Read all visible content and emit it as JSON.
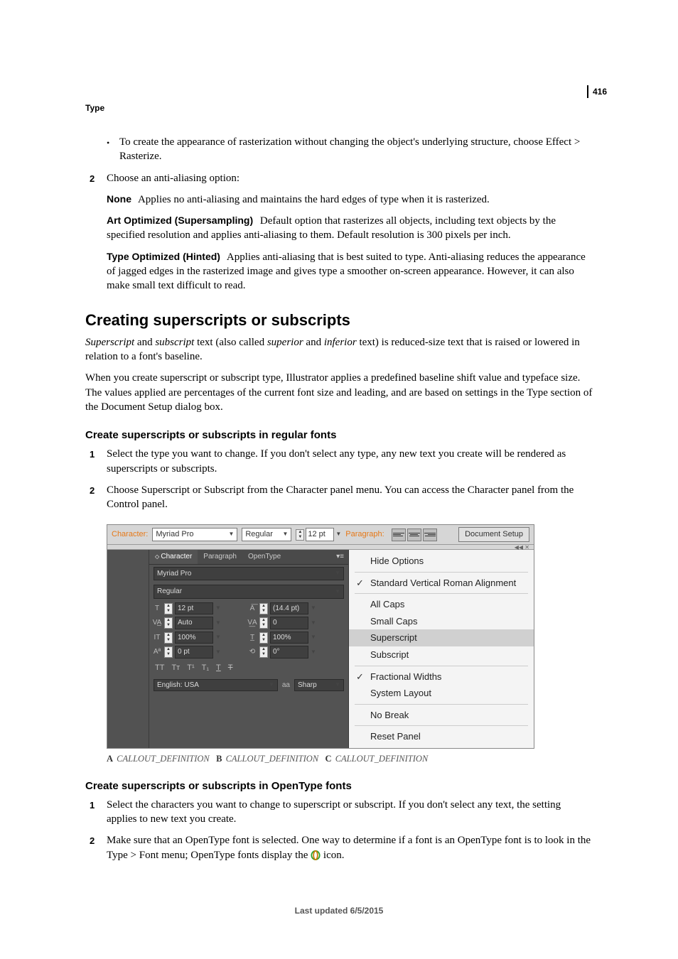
{
  "page_number": "416",
  "chapter": "Type",
  "intro_bullet": "To create the appearance of rasterization without changing the object's underlying structure, choose Effect > Rasterize.",
  "step2_lead": "Choose an anti-aliasing option:",
  "defs": {
    "none": {
      "term": "None",
      "body": "Applies no anti-aliasing and maintains the hard edges of type when it is rasterized."
    },
    "art": {
      "term": "Art Optimized (Supersampling)",
      "body": "Default option that rasterizes all objects, including text objects by the specified resolution and applies anti-aliasing to them. Default resolution is 300 pixels per inch."
    },
    "type": {
      "term": "Type Optimized (Hinted)",
      "body": "Applies anti-aliasing that is best suited to type. Anti-aliasing reduces the appearance of jagged edges in the rasterized image and gives type a smoother on-screen appearance. However, it can also make small text difficult to read."
    }
  },
  "h2": "Creating superscripts or subscripts",
  "p1a": "Superscript",
  "p1b": " and ",
  "p1c": "subscript",
  "p1d": " text (also called ",
  "p1e": "superior",
  "p1f": " and ",
  "p1g": "inferior",
  "p1h": " text) is reduced-size text that is raised or lowered in relation to a font's baseline.",
  "p2": "When you create superscript or subscript type, Illustrator applies a predefined baseline shift value and typeface size. The values applied are percentages of the current font size and leading, and are based on settings in the Type section of the Document Setup dialog box.",
  "h3a": "Create superscripts or subscripts in regular fonts",
  "h3a_step1": "Select the type you want to change. If you don't select any type, any new text you create will be rendered as superscripts or subscripts.",
  "h3a_step2": "Choose Superscript or Subscript from the Character panel menu. You can access the Character panel from the Control panel.",
  "ctrlbar": {
    "character_label": "Character:",
    "font": "Myriad Pro",
    "style": "Regular",
    "size": "12 pt",
    "paragraph_label": "Paragraph:",
    "doc_setup": "Document Setup"
  },
  "panel": {
    "tabs": {
      "character": "Character",
      "paragraph": "Paragraph",
      "opentype": "OpenType"
    },
    "font": "Myriad Pro",
    "style": "Regular",
    "size": "12 pt",
    "leading": "(14.4 pt)",
    "kerning": "Auto",
    "tracking": "0",
    "vscale": "100%",
    "hscale": "100%",
    "baseline": "0 pt",
    "rotation": "0°",
    "lang": "English: USA",
    "aa": "Sharp",
    "aa_prefix": "aa"
  },
  "menu": {
    "hide": "Hide Options",
    "svra": "Standard Vertical Roman Alignment",
    "allcaps": "All Caps",
    "smallcaps": "Small Caps",
    "superscript": "Superscript",
    "subscript": "Subscript",
    "frac": "Fractional Widths",
    "system": "System Layout",
    "nobreak": "No Break",
    "reset": "Reset Panel"
  },
  "callout": {
    "a": "A",
    "adesc": "CALLOUT_DEFINITION",
    "b": "B",
    "bdesc": "CALLOUT_DEFINITION",
    "c": "C",
    "cdesc": "CALLOUT_DEFINITION"
  },
  "h3b": "Create superscripts or subscripts in OpenType fonts",
  "h3b_step1": "Select the characters you want to change to superscript or subscript. If you don't select any text, the setting applies to new text you create.",
  "h3b_step2a": "Make sure that an OpenType font is selected. One way to determine if a font is an OpenType font is to look in the Type > Font menu; OpenType fonts display the ",
  "h3b_step2b": " icon.",
  "footer": "Last updated 6/5/2015",
  "nums": {
    "one": "1",
    "two": "2"
  }
}
